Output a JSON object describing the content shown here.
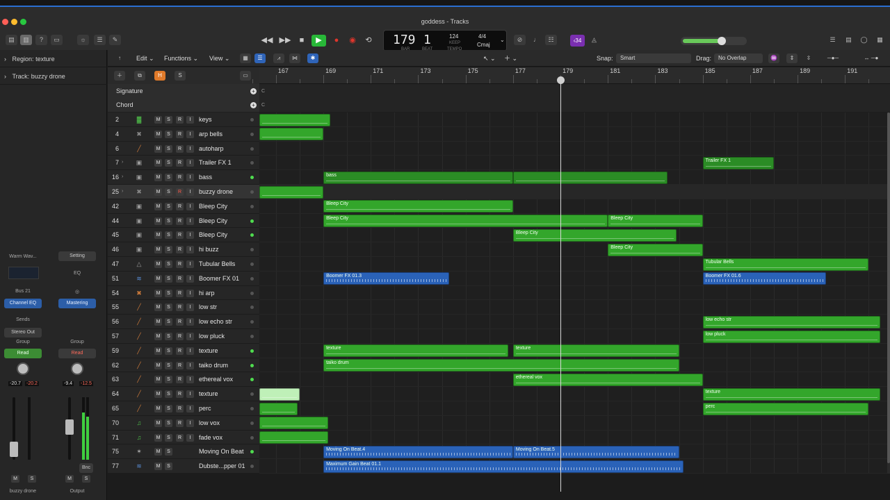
{
  "window": {
    "title": "goddess - Tracks"
  },
  "lcd": {
    "bar": "179",
    "beat": "1",
    "bar_label": "BAR",
    "beat_label": "BEAT",
    "tempo": "124",
    "keep_label": "KEEP",
    "tempo_label": "TEMPO",
    "time_signature": "4/4",
    "key": "Cmaj"
  },
  "cpu_badge": "‹34",
  "master_volume_fraction": 0.62,
  "inspector": {
    "region_label": "Region:",
    "region_name": "texture",
    "track_label": "Track:",
    "track_name": "buzzy drone",
    "strip1": {
      "plugin": "Warm Wav...",
      "bus": "Bus 21",
      "eq": "Channel EQ",
      "sends": "Sends",
      "output": "Stereo Out",
      "group": "Group",
      "automation": "Read",
      "vol": "-20.7",
      "peak": "-20.2",
      "m": "M",
      "s": "S",
      "name": "buzzy drone"
    },
    "strip2": {
      "setting": "Setting",
      "eq": "EQ",
      "mastering": "Mastering",
      "group": "Group",
      "automation": "Read",
      "vol": "-9.4",
      "peak": "-12.5",
      "bnc": "Bnc",
      "m": "M",
      "s": "S",
      "name": "Output"
    }
  },
  "toolbar": {
    "edit": "Edit",
    "functions": "Functions",
    "view": "View",
    "snap_label": "Snap:",
    "snap_value": "Smart",
    "drag_label": "Drag:",
    "drag_value": "No Overlap"
  },
  "header_buttons": {
    "h": "H",
    "s": "S"
  },
  "global_tracks": {
    "signature": "Signature",
    "chord": "Chord",
    "sig_marker": "C",
    "chord_marker": "C"
  },
  "track_buttons": {
    "m": "M",
    "s": "S",
    "r": "R",
    "i": "I"
  },
  "ruler": [
    "167",
    "169",
    "171",
    "173",
    "175",
    "177",
    "179",
    "181",
    "183",
    "185",
    "187",
    "189",
    "191"
  ],
  "tracks": [
    {
      "num": "2",
      "name": "keys",
      "icon": "keyboard-icon",
      "color": "#4fbf4a",
      "glyph": "▓",
      "active": false,
      "disclosure": false
    },
    {
      "num": "4",
      "name": "arp bells",
      "icon": "synth-icon",
      "color": "#888888",
      "glyph": "✖",
      "active": false,
      "disclosure": false
    },
    {
      "num": "6",
      "name": "autoharp",
      "icon": "harp-icon",
      "color": "#c8783a",
      "glyph": "╱",
      "active": false,
      "disclosure": false
    },
    {
      "num": "7",
      "name": "Trailer FX 1",
      "icon": "drum-machine-icon",
      "color": "#999999",
      "glyph": "▣",
      "active": false,
      "disclosure": true
    },
    {
      "num": "16",
      "name": "bass",
      "icon": "drum-machine-icon",
      "color": "#999999",
      "glyph": "▣",
      "active": true,
      "disclosure": true
    },
    {
      "num": "25",
      "name": "buzzy drone",
      "icon": "synth-icon",
      "color": "#888888",
      "glyph": "✖",
      "active": false,
      "disclosure": true,
      "selected": true,
      "armed": true
    },
    {
      "num": "42",
      "name": "Bleep City",
      "icon": "drum-machine-icon",
      "color": "#999999",
      "glyph": "▣",
      "active": false,
      "disclosure": false
    },
    {
      "num": "44",
      "name": "Bleep City",
      "icon": "drum-machine-icon",
      "color": "#999999",
      "glyph": "▣",
      "active": true,
      "disclosure": false
    },
    {
      "num": "45",
      "name": "Bleep City",
      "icon": "drum-machine-icon",
      "color": "#999999",
      "glyph": "▣",
      "active": true,
      "disclosure": false
    },
    {
      "num": "46",
      "name": "hi buzz",
      "icon": "drum-machine-icon",
      "color": "#999999",
      "glyph": "▣",
      "active": false,
      "disclosure": false
    },
    {
      "num": "47",
      "name": "Tubular Bells",
      "icon": "bells-icon",
      "color": "#999999",
      "glyph": "△",
      "active": false,
      "disclosure": false
    },
    {
      "num": "51",
      "name": "Boomer FX 01",
      "icon": "waveform-icon",
      "color": "#5a8fd8",
      "glyph": "≋",
      "active": false,
      "disclosure": false
    },
    {
      "num": "54",
      "name": "hi arp",
      "icon": "synth-icon",
      "color": "#c8783a",
      "glyph": "✖",
      "active": false,
      "disclosure": false
    },
    {
      "num": "55",
      "name": "low str",
      "icon": "violin-icon",
      "color": "#c8783a",
      "glyph": "╱",
      "active": false,
      "disclosure": false
    },
    {
      "num": "56",
      "name": "low echo str",
      "icon": "violin-icon",
      "color": "#c8783a",
      "glyph": "╱",
      "active": false,
      "disclosure": false
    },
    {
      "num": "57",
      "name": "low pluck",
      "icon": "violin-icon",
      "color": "#c8783a",
      "glyph": "╱",
      "active": false,
      "disclosure": false
    },
    {
      "num": "59",
      "name": "texture",
      "icon": "violin-icon",
      "color": "#c8783a",
      "glyph": "╱",
      "active": true,
      "disclosure": false
    },
    {
      "num": "62",
      "name": "taiko drum",
      "icon": "violin-icon",
      "color": "#c8783a",
      "glyph": "╱",
      "active": true,
      "disclosure": false
    },
    {
      "num": "63",
      "name": "ethereal vox",
      "icon": "violin-icon",
      "color": "#c8783a",
      "glyph": "╱",
      "active": true,
      "disclosure": false
    },
    {
      "num": "64",
      "name": "texture",
      "icon": "violin-icon",
      "color": "#c8783a",
      "glyph": "╱",
      "active": false,
      "disclosure": false
    },
    {
      "num": "65",
      "name": "perc",
      "icon": "violin-icon",
      "color": "#c8783a",
      "glyph": "╱",
      "active": false,
      "disclosure": false
    },
    {
      "num": "70",
      "name": "low vox",
      "icon": "music-note-icon",
      "color": "#4fbf4a",
      "glyph": "♫",
      "active": false,
      "disclosure": false
    },
    {
      "num": "71",
      "name": "fade vox",
      "icon": "music-note-icon",
      "color": "#4fbf4a",
      "glyph": "♫",
      "active": false,
      "disclosure": false
    },
    {
      "num": "75",
      "name": "Moving On Beat",
      "icon": "beat-icon",
      "color": "#aaaaaa",
      "glyph": "✶",
      "active": true,
      "disclosure": false,
      "audio": true
    },
    {
      "num": "77",
      "name": "Dubste...pper 01",
      "icon": "waveform-icon",
      "color": "#5a8fd8",
      "glyph": "≋",
      "active": false,
      "disclosure": false,
      "audio": true
    }
  ],
  "regions": [
    {
      "lane": 0,
      "start": 166.0,
      "end": 169.3,
      "label": "",
      "kind": "green"
    },
    {
      "lane": 1,
      "start": 166.0,
      "end": 169.0,
      "label": "",
      "kind": "green"
    },
    {
      "lane": 3,
      "start": 185.0,
      "end": 188.0,
      "label": "Trailer FX 1",
      "kind": "green dark"
    },
    {
      "lane": 4,
      "start": 169.0,
      "end": 177.0,
      "label": "bass",
      "kind": "green dark"
    },
    {
      "lane": 4,
      "start": 177.0,
      "end": 183.5,
      "label": "",
      "kind": "green dark"
    },
    {
      "lane": 5,
      "start": 166.0,
      "end": 169.0,
      "label": "",
      "kind": "green"
    },
    {
      "lane": 6,
      "start": 169.0,
      "end": 177.0,
      "label": "Bleep City",
      "kind": "green"
    },
    {
      "lane": 7,
      "start": 169.0,
      "end": 181.0,
      "label": "Bleep City",
      "kind": "green"
    },
    {
      "lane": 7,
      "start": 181.0,
      "end": 185.0,
      "label": "Bleep City",
      "kind": "green"
    },
    {
      "lane": 8,
      "start": 177.0,
      "end": 183.9,
      "label": "Bleep City",
      "kind": "green"
    },
    {
      "lane": 9,
      "start": 181.0,
      "end": 185.0,
      "label": "Bleep City",
      "kind": "green"
    },
    {
      "lane": 10,
      "start": 185.0,
      "end": 192.0,
      "label": "Tubular Bells",
      "kind": "green"
    },
    {
      "lane": 11,
      "start": 169.0,
      "end": 174.3,
      "label": "Boomer FX 01.3",
      "kind": "blue"
    },
    {
      "lane": 11,
      "start": 185.0,
      "end": 190.2,
      "label": "Boomer FX 01.6",
      "kind": "blue"
    },
    {
      "lane": 14,
      "start": 185.0,
      "end": 192.5,
      "label": "low echo str",
      "kind": "green"
    },
    {
      "lane": 15,
      "start": 185.0,
      "end": 192.5,
      "label": "low pluck",
      "kind": "green"
    },
    {
      "lane": 16,
      "start": 169.0,
      "end": 176.8,
      "label": "texture",
      "kind": "green"
    },
    {
      "lane": 16,
      "start": 177.0,
      "end": 184.0,
      "label": "texture",
      "kind": "green"
    },
    {
      "lane": 17,
      "start": 169.0,
      "end": 184.0,
      "label": "taiko drum",
      "kind": "green"
    },
    {
      "lane": 18,
      "start": 177.0,
      "end": 185.0,
      "label": "ethereal vox",
      "kind": "green"
    },
    {
      "lane": 19,
      "start": 166.0,
      "end": 168.0,
      "label": "",
      "kind": "lightgreen"
    },
    {
      "lane": 19,
      "start": 185.0,
      "end": 192.5,
      "label": "texture",
      "kind": "green"
    },
    {
      "lane": 20,
      "start": 166.0,
      "end": 167.9,
      "label": "",
      "kind": "green"
    },
    {
      "lane": 20,
      "start": 185.0,
      "end": 192.0,
      "label": "perc",
      "kind": "green"
    },
    {
      "lane": 21,
      "start": 166.0,
      "end": 169.2,
      "label": "",
      "kind": "green"
    },
    {
      "lane": 22,
      "start": 166.0,
      "end": 169.2,
      "label": "",
      "kind": "green"
    },
    {
      "lane": 23,
      "start": 169.0,
      "end": 177.0,
      "label": "Moving On Beat.4",
      "kind": "blue"
    },
    {
      "lane": 23,
      "start": 177.0,
      "end": 184.0,
      "label": "Moving On Beat.5",
      "kind": "blue"
    },
    {
      "lane": 24,
      "start": 169.0,
      "end": 184.2,
      "label": "Maximum Gain Beat 01.1",
      "kind": "blue"
    }
  ],
  "playhead_bar": 179.0
}
